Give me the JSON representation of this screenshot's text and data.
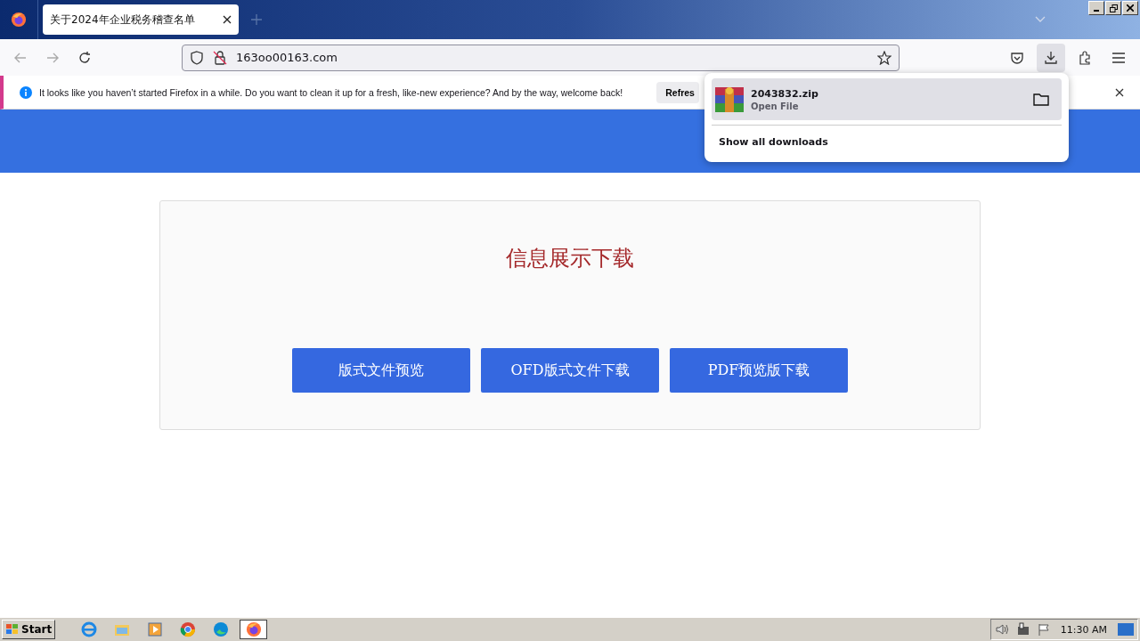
{
  "tabs": [
    {
      "title": "关于2024年企业税务稽查名单",
      "selected": true
    }
  ],
  "address_bar": {
    "url": "163oo00163.com"
  },
  "notification": {
    "message": "It looks like you haven’t started Firefox in a while. Do you want to clean it up for a fresh, like-new experience? And by the way, welcome back!",
    "button": "Refres"
  },
  "downloads_panel": {
    "items": [
      {
        "file": "2043832.zip",
        "status": "Open File"
      }
    ],
    "show_all": "Show all downloads"
  },
  "page": {
    "heading": "信息展示下载",
    "buttons": [
      "版式文件预览",
      "OFD版式文件下载",
      "PDF预览版下载"
    ]
  },
  "taskbar": {
    "start": "Start",
    "apps": [
      {
        "kind": "ie",
        "selected": false
      },
      {
        "kind": "explorer",
        "selected": false
      },
      {
        "kind": "media",
        "selected": false
      },
      {
        "kind": "chrome",
        "selected": false
      },
      {
        "kind": "edge",
        "selected": false
      },
      {
        "kind": "firefox",
        "selected": true
      }
    ],
    "clock": "11:30 AM"
  }
}
